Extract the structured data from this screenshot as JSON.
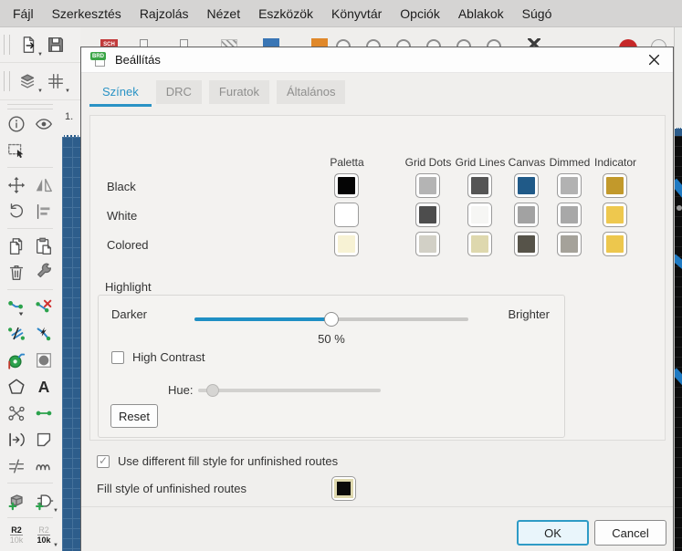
{
  "menu": {
    "items": [
      "Fájl",
      "Szerkesztés",
      "Rajzolás",
      "Nézet",
      "Eszközök",
      "Könyvtár",
      "Opciók",
      "Ablakok",
      "Súgó"
    ]
  },
  "toolbar": {
    "sch_label": "SCH"
  },
  "canvas": {
    "ruler_label": "1."
  },
  "sidebar": {
    "text_tool_label": "A",
    "refdes_a": {
      "top": "R2",
      "bottom": "10k"
    },
    "refdes_b": {
      "top": "R2",
      "bottom": "10k"
    }
  },
  "dialog": {
    "title": "Beállítás",
    "icon_label": "BRD",
    "tabs": [
      {
        "label": "Színek",
        "active": true
      },
      {
        "label": "DRC",
        "active": false
      },
      {
        "label": "Furatok",
        "active": false
      },
      {
        "label": "Általános",
        "active": false
      }
    ],
    "color_table": {
      "headers": [
        "Paletta",
        "Grid Dots",
        "Grid Lines",
        "Canvas",
        "Dimmed",
        "Indicator"
      ],
      "rows": [
        {
          "label": "Black",
          "colors": [
            "#050505",
            "#b4b4b4",
            "#555555",
            "#205a88",
            "#b2b2b2",
            "#c2992b"
          ]
        },
        {
          "label": "White",
          "colors": [
            "#ffffff",
            "#4d4d4d",
            "#f6f6f4",
            "#a2a2a2",
            "#a8a8a8",
            "#eec84e"
          ]
        },
        {
          "label": "Colored",
          "colors": [
            "#f7f2d4",
            "#d2d0c6",
            "#ded8ae",
            "#565349",
            "#a5a29a",
            "#edc74d"
          ]
        }
      ]
    },
    "highlight": {
      "section_label": "Highlight",
      "darker_label": "Darker",
      "brighter_label": "Brighter",
      "value_percent": 50,
      "value_label": "50 %",
      "high_contrast_label": "High Contrast",
      "high_contrast_checked": false,
      "hue_label": "Hue:",
      "hue_percent": 8,
      "reset_label": "Reset"
    },
    "fill_style": {
      "use_checkbox_label": "Use different fill style for unfinished routes",
      "use_checked": true,
      "row_label": "Fill style of unfinished routes",
      "swatch_fill": "#0a0a0a",
      "swatch_ring": "#ded8ae"
    },
    "buttons": {
      "ok": "OK",
      "cancel": "Cancel"
    }
  },
  "colors": {
    "accent_blue": "#2a93c5",
    "canvas_blue": "#2d5d8b",
    "trace_blue": "#1f7ac2",
    "indicator_gold": "#eec84e"
  }
}
